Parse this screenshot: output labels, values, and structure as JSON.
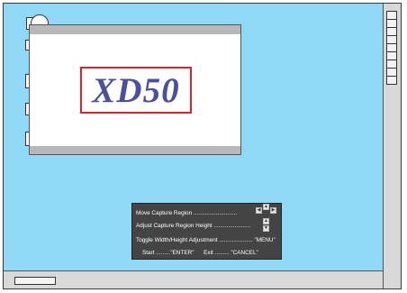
{
  "projector_preview": {
    "model_name": "XD50",
    "border_color": "#d9242f",
    "text_color": "#4b4f9f"
  },
  "osd": {
    "move_label": "Move Capture Region",
    "move_dots": "...........................",
    "adjust_label": "Adjust Capture Region Height",
    "adjust_dots": ".......................",
    "toggle_label": "Toggle Width/Height Adjustment",
    "toggle_dots": ".....................",
    "toggle_key": "\"MENU\"",
    "start_label": "Start",
    "start_dots": ".........",
    "start_key": "\"ENTER\"",
    "exit_label": "Exit",
    "exit_dots": ".........",
    "exit_key": "\"CANCEL\"",
    "arrow_left": "◀",
    "arrow_up": "▲",
    "arrow_right": "▶",
    "arrow_down": "▼"
  },
  "colors": {
    "screen_bg": "#8fd9f6",
    "osd_bg": "#444444"
  }
}
